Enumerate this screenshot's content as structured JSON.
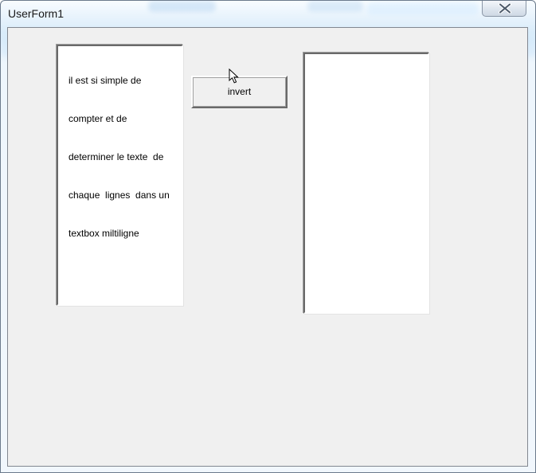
{
  "window": {
    "title": "UserForm1",
    "close_icon": "close-x-icon"
  },
  "form": {
    "left_textbox": {
      "lines": [
        "il est si simple de",
        "compter et de",
        "determiner le texte  de",
        "chaque  lignes  dans un",
        "textbox miltiligne"
      ]
    },
    "invert_button": {
      "label": "invert"
    },
    "right_textbox": {
      "value": ""
    },
    "mouse_cursor_icon": "arrow-cursor-icon"
  }
}
